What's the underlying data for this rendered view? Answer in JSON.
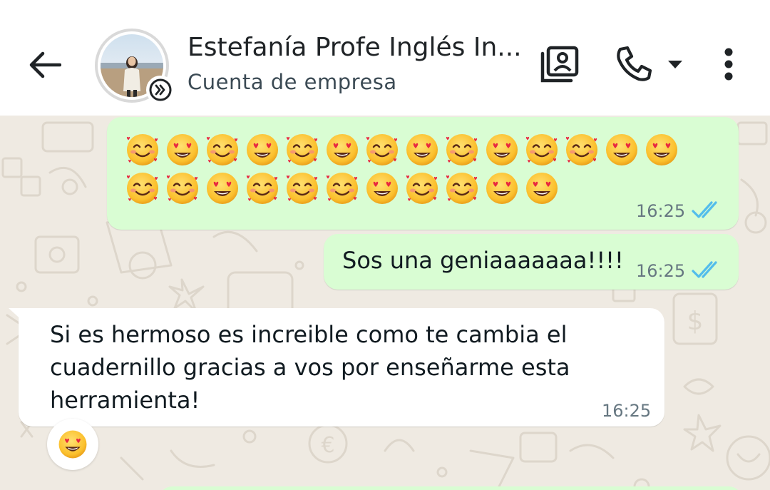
{
  "header": {
    "contact_name": "Estefanía Profe Inglés In...",
    "contact_subtitle": "Cuenta de empresa",
    "icons": [
      "back-arrow-icon",
      "business-account-icon",
      "contact-card-icon",
      "phone-icon",
      "dropdown-caret-icon",
      "more-vert-icon"
    ]
  },
  "messages": [
    {
      "direction": "outgoing",
      "emojis": [
        "smiling-face-with-hearts",
        "heart-eyes",
        "smiling-face-with-hearts",
        "heart-eyes",
        "smiling-face-with-hearts",
        "heart-eyes",
        "smiling-face-with-hearts",
        "heart-eyes",
        "smiling-face-with-hearts",
        "heart-eyes",
        "smiling-face-with-hearts",
        "smiling-face-with-hearts",
        "heart-eyes",
        "heart-eyes",
        "smiling-face-with-hearts",
        "smiling-face-with-hearts",
        "heart-eyes",
        "smiling-face-with-hearts",
        "smiling-face-with-hearts",
        "smiling-face-with-hearts",
        "heart-eyes",
        "smiling-face-with-hearts",
        "smiling-face-with-hearts",
        "heart-eyes",
        "heart-eyes"
      ],
      "time": "16:25",
      "status": "read"
    },
    {
      "direction": "outgoing",
      "text": "Sos una geniaaaaaaa!!!!",
      "time": "16:25",
      "status": "read"
    },
    {
      "direction": "incoming",
      "lines": [
        "Si es hermoso es increible como te cambia el",
        "cuadernillo gracias a vos por enseñarme esta",
        "herramienta!"
      ],
      "time": "16:25",
      "reaction": "heart-eyes"
    }
  ],
  "colors": {
    "outgoing_bubble": "#d9fdd3",
    "incoming_bubble": "#ffffff",
    "wallpaper": "#efeae2",
    "read_ticks": "#53bdeb",
    "timestamp": "#667781"
  }
}
